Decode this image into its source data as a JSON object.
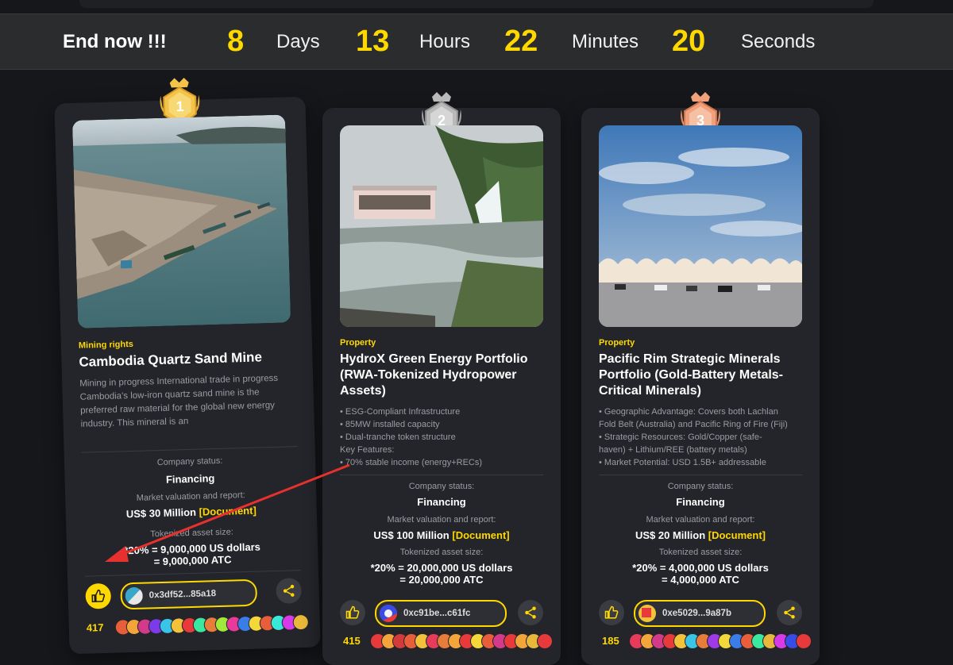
{
  "countdown": {
    "title": "End now !!!",
    "days": "8",
    "days_label": "Days",
    "hours": "13",
    "hours_label": "Hours",
    "minutes": "22",
    "minutes_label": "Minutes",
    "seconds": "20",
    "seconds_label": "Seconds"
  },
  "cards": [
    {
      "rank": "1",
      "category": "Mining rights",
      "title": "Cambodia Quartz Sand Mine",
      "desc": [
        "Mining in progress International trade in progress",
        "Cambodia's low-iron quartz sand mine is the preferred raw material for the global new energy industry. This mineral is an"
      ],
      "status_label": "Company status:",
      "status": "Financing",
      "valuation_label": "Market valuation and report:",
      "valuation": "US$ 30 Million",
      "document": "[Document]",
      "token_label": "Tokenized asset size:",
      "token_line1": "*20% = 9,000,000 US dollars",
      "token_line2": "= 9,000,000 ATC",
      "address": "0x3df52...85a18",
      "likes": "417"
    },
    {
      "rank": "2",
      "category": "Property",
      "title": "HydroX Green Energy Portfolio (RWA-Tokenized Hydropower Assets)",
      "desc": [
        "• ESG-Compliant Infrastructure",
        "• 85MW installed capacity",
        "• Dual-tranche token structure",
        "Key Features:",
        "• 70% stable income (energy+RECs)"
      ],
      "status_label": "Company status:",
      "status": "Financing",
      "valuation_label": "Market valuation and report:",
      "valuation": "US$ 100 Million",
      "document": "[Document]",
      "token_label": "Tokenized asset size:",
      "token_line1": "*20% = 20,000,000 US dollars",
      "token_line2": "= 20,000,000 ATC",
      "address": "0xc91be...c61fc",
      "likes": "415"
    },
    {
      "rank": "3",
      "category": "Property",
      "title": "Pacific Rim Strategic Minerals Portfolio (Gold-Battery Metals-Critical Minerals)",
      "desc": [
        "• Geographic Advantage: Covers both Lachlan",
        "Fold Belt (Australia) and Pacific Ring of Fire (Fiji)",
        "• Strategic Resources: Gold/Copper (safe-",
        "haven) + Lithium/REE (battery metals)",
        "• Market Potential: USD 1.5B+ addressable"
      ],
      "status_label": "Company status:",
      "status": "Financing",
      "valuation_label": "Market valuation and report:",
      "valuation": "US$ 20 Million",
      "document": "[Document]",
      "token_label": "Tokenized asset size:",
      "token_line1": "*20% = 4,000,000 US dollars",
      "token_line2": "= 4,000,000 ATC",
      "address": "0xe5029...9a87b",
      "likes": "185"
    }
  ],
  "colors": {
    "accent": "#ffd800",
    "card_bg": "#23252a",
    "page_bg": "#16171b",
    "arrow": "#e8312f",
    "gold_medal": "#f3c34a",
    "silver_medal": "#b9b9b9",
    "bronze_medal": "#f0a07a"
  },
  "icons": {
    "like": "thumbs-up-icon",
    "share": "share-icon",
    "medal": "rank-medal-icon"
  }
}
